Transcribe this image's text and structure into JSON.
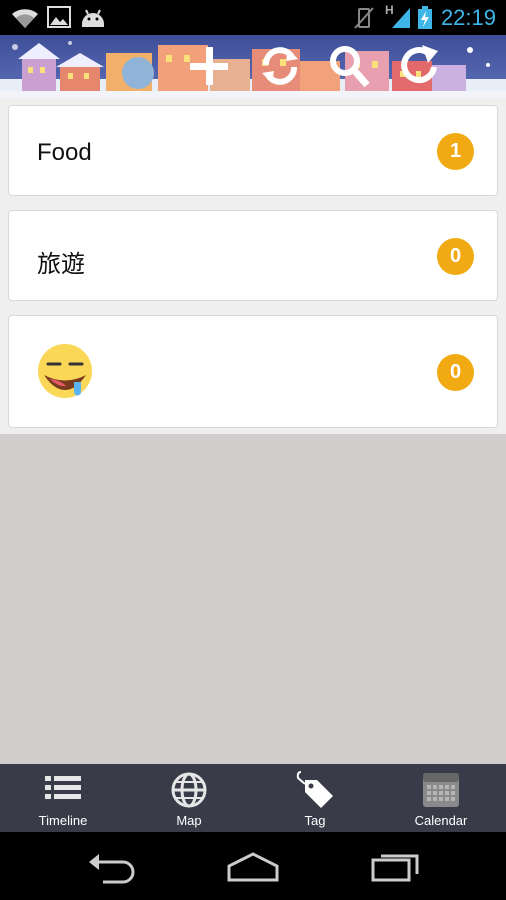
{
  "status_bar": {
    "time": "22:19",
    "network_label": "H",
    "icons": [
      "wifi-icon",
      "image-icon",
      "android-icon",
      "vibrate-off-icon",
      "signal-icon",
      "battery-charging-icon"
    ]
  },
  "header": {
    "icons": [
      "add-icon",
      "sync-icon",
      "search-icon",
      "refresh-icon"
    ]
  },
  "tags": [
    {
      "label": "Food",
      "count": "1"
    },
    {
      "label": "旅遊",
      "count": "0"
    },
    {
      "label": "",
      "emoji": "drooling-face-icon",
      "count": "0"
    }
  ],
  "tab_bar": {
    "tabs": [
      {
        "label": "Timeline",
        "icon": "list-icon",
        "selected": false
      },
      {
        "label": "Map",
        "icon": "globe-icon",
        "selected": false
      },
      {
        "label": "Tag",
        "icon": "tag-icon",
        "selected": true
      },
      {
        "label": "Calendar",
        "icon": "calendar-icon",
        "selected": false
      }
    ]
  },
  "nav_bar": {
    "buttons": [
      "back-icon",
      "home-icon",
      "recent-apps-icon"
    ]
  },
  "colors": {
    "badge": "#f2aa13",
    "tab_bar": "#393c48",
    "clock": "#3fb6e8",
    "empty_area": "#d1cdcd"
  }
}
